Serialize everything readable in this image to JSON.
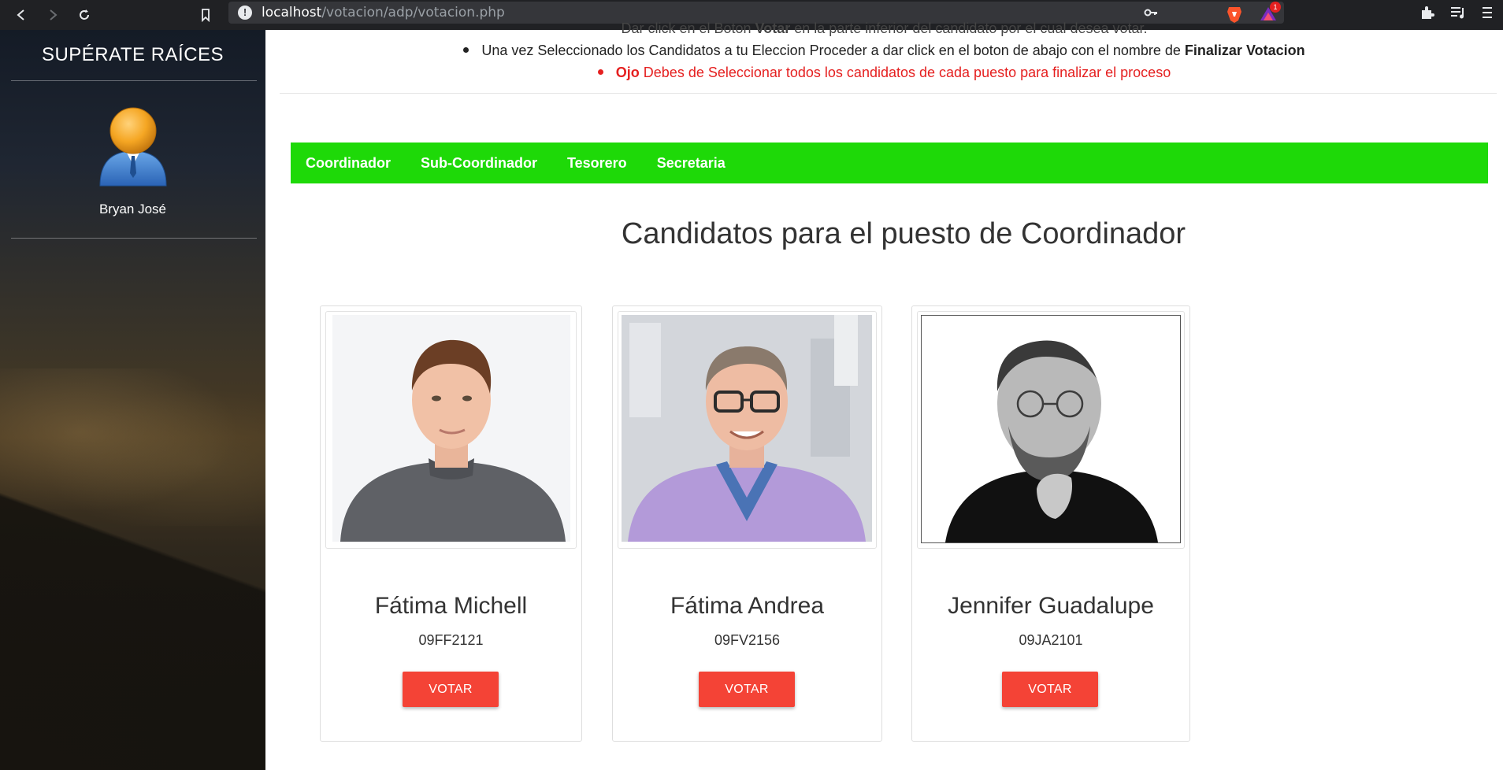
{
  "browser": {
    "url_host": "localhost",
    "url_path": "/votacion/adp/votacion.php",
    "ext_badge": "1"
  },
  "sidebar": {
    "brand": "SUPÉRATE RAÍCES",
    "username": "Bryan José"
  },
  "instructions": {
    "line1_partial_a": "Dar click en el Boton ",
    "line1_partial_bold": "Votar",
    "line1_partial_b": " en la parte inferior del candidato por el cual desea votar.",
    "line2_text": "Una vez Seleccionado los Candidatos a tu Eleccion Proceder a dar click en el boton de abajo con el nombre de ",
    "line2_bold": "Finalizar Votacion",
    "line3_bold": "Ojo",
    "line3_text": " Debes de Seleccionar todos los candidatos de cada puesto para finalizar el proceso"
  },
  "tabs": [
    "Coordinador",
    "Sub-Coordinador",
    "Tesorero",
    "Secretaria"
  ],
  "section_title": "Candidatos para el puesto de Coordinador",
  "candidates": [
    {
      "name": "Fátima Michell",
      "code": "09FF2121",
      "button": "VOTAR"
    },
    {
      "name": "Fátima Andrea",
      "code": "09FV2156",
      "button": "VOTAR"
    },
    {
      "name": "Jennifer Guadalupe",
      "code": "09JA2101",
      "button": "VOTAR"
    }
  ],
  "colors": {
    "tab_bar": "#1ed908",
    "vote_button": "#f44336",
    "warning_text": "#e52020",
    "chrome_bg": "#202124"
  }
}
